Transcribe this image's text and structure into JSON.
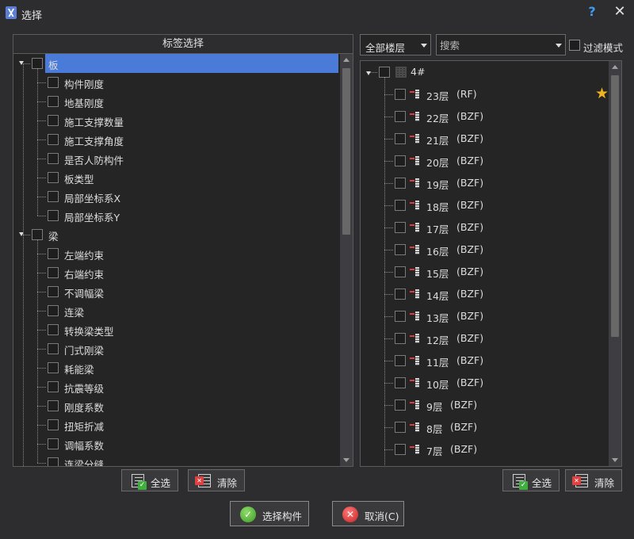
{
  "window": {
    "title": "选择",
    "help_label": "?",
    "close_label": "✕"
  },
  "left": {
    "header": "标签选择",
    "groups": [
      {
        "label": "板",
        "selected": true,
        "children": [
          "构件刚度",
          "地基刚度",
          "施工支撑数量",
          "施工支撑角度",
          "是否人防构件",
          "板类型",
          "局部坐标系X",
          "局部坐标系Y"
        ]
      },
      {
        "label": "梁",
        "selected": false,
        "children": [
          "左端约束",
          "右端约束",
          "不调幅梁",
          "连梁",
          "转换梁类型",
          "门式刚梁",
          "耗能梁",
          "抗震等级",
          "刚度系数",
          "扭矩折减",
          "调幅系数",
          "连梁分缝"
        ]
      }
    ],
    "select_all_label": "全选",
    "clear_label": "清除"
  },
  "right": {
    "floor_filter": {
      "value": "全部楼层"
    },
    "search": {
      "placeholder": "搜索",
      "value": ""
    },
    "filter_mode_label": "过滤模式",
    "building": "4#",
    "floors": [
      {
        "name": "23层",
        "tag": "(RF)"
      },
      {
        "name": "22层",
        "tag": "(BZF)"
      },
      {
        "name": "21层",
        "tag": "(BZF)"
      },
      {
        "name": "20层",
        "tag": "(BZF)"
      },
      {
        "name": "19层",
        "tag": "(BZF)"
      },
      {
        "name": "18层",
        "tag": "(BZF)"
      },
      {
        "name": "17层",
        "tag": "(BZF)"
      },
      {
        "name": "16层",
        "tag": "(BZF)"
      },
      {
        "name": "15层",
        "tag": "(BZF)"
      },
      {
        "name": "14层",
        "tag": "(BZF)"
      },
      {
        "name": "13层",
        "tag": "(BZF)"
      },
      {
        "name": "12层",
        "tag": "(BZF)"
      },
      {
        "name": "11层",
        "tag": "(BZF)"
      },
      {
        "name": "10层",
        "tag": "(BZF)"
      },
      {
        "name": "9层",
        "tag": "(BZF)"
      },
      {
        "name": "8层",
        "tag": "(BZF)"
      },
      {
        "name": "7层",
        "tag": "(BZF)"
      }
    ],
    "select_all_label": "全选",
    "clear_label": "清除"
  },
  "footer": {
    "confirm_label": "选择构件",
    "cancel_label": "取消(C)"
  },
  "colors": {
    "accent": "#4a7bd9",
    "star": "#f2b321",
    "bg": "#2d2d30"
  }
}
